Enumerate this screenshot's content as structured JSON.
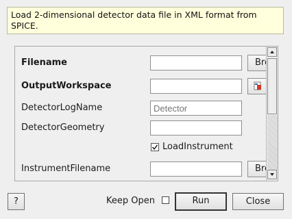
{
  "description": "Load 2-dimensional detector data file in XML format from SPICE.",
  "fields": [
    {
      "label": "Filename",
      "bold": true,
      "value": "",
      "placeholder": "",
      "button": "Browse"
    },
    {
      "label": "OutputWorkspace",
      "bold": true,
      "value": "",
      "placeholder": "",
      "icon": "workspace-icon"
    },
    {
      "label": "DetectorLogName",
      "bold": false,
      "value": "",
      "placeholder": "Detector"
    },
    {
      "label": "DetectorGeometry",
      "bold": false,
      "value": "",
      "placeholder": ""
    },
    {
      "label": "LoadInstrument",
      "checked": true
    },
    {
      "label": "InstrumentFilename",
      "bold": false,
      "value": "",
      "placeholder": "",
      "button": "Browse"
    }
  ],
  "footer": {
    "help_label": "?",
    "keep_open_label": "Keep Open",
    "keep_open_checked": false,
    "run_label": "Run",
    "close_label": "Close"
  },
  "colors": {
    "description_bg": "#ffffdc",
    "window_bg": "#efefef"
  }
}
